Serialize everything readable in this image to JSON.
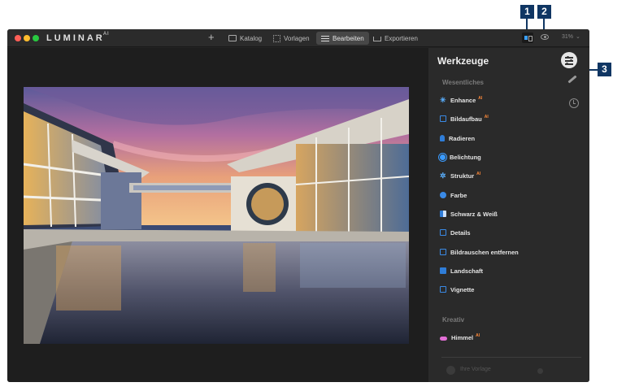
{
  "app": {
    "brand": "LUMINAR",
    "brand_suffix": "AI"
  },
  "toolbar": {
    "add_label": "+",
    "tabs": [
      {
        "label": "Katalog",
        "icon": "folder-icon"
      },
      {
        "label": "Vorlagen",
        "icon": "templates-icon"
      },
      {
        "label": "Bearbeiten",
        "icon": "edit-sliders-icon",
        "active": true
      },
      {
        "label": "Exportieren",
        "icon": "export-icon"
      }
    ],
    "zoom": "31%"
  },
  "panel": {
    "title": "Werkzeuge",
    "sections": [
      {
        "heading": "Wesentliches",
        "tools": [
          {
            "label": "Enhance",
            "badge": "AI",
            "icon": "sparkle-icon"
          },
          {
            "label": "Bildaufbau",
            "badge": "AI",
            "icon": "crop-icon"
          },
          {
            "label": "Radieren",
            "badge": "",
            "icon": "eraser-icon"
          },
          {
            "label": "Belichtung",
            "badge": "",
            "icon": "sun-icon"
          },
          {
            "label": "Struktur",
            "badge": "AI",
            "icon": "structure-icon"
          },
          {
            "label": "Farbe",
            "badge": "",
            "icon": "color-icon"
          },
          {
            "label": "Schwarz & Weiß",
            "badge": "",
            "icon": "bw-icon"
          },
          {
            "label": "Details",
            "badge": "",
            "icon": "details-icon"
          },
          {
            "label": "Bildrauschen entfernen",
            "badge": "",
            "icon": "denoise-icon"
          },
          {
            "label": "Landschaft",
            "badge": "",
            "icon": "landscape-icon"
          },
          {
            "label": "Vignette",
            "badge": "",
            "icon": "vignette-icon"
          }
        ]
      },
      {
        "heading": "Kreativ",
        "tools": [
          {
            "label": "Himmel",
            "badge": "AI",
            "icon": "cloud-icon"
          }
        ]
      }
    ],
    "footer_label": "Ihre Vorlage"
  },
  "callouts": [
    "1",
    "2",
    "3"
  ],
  "colors": {
    "accent": "#2f7dd8",
    "callout": "#103663",
    "ai_badge": "#ff8a3a"
  }
}
